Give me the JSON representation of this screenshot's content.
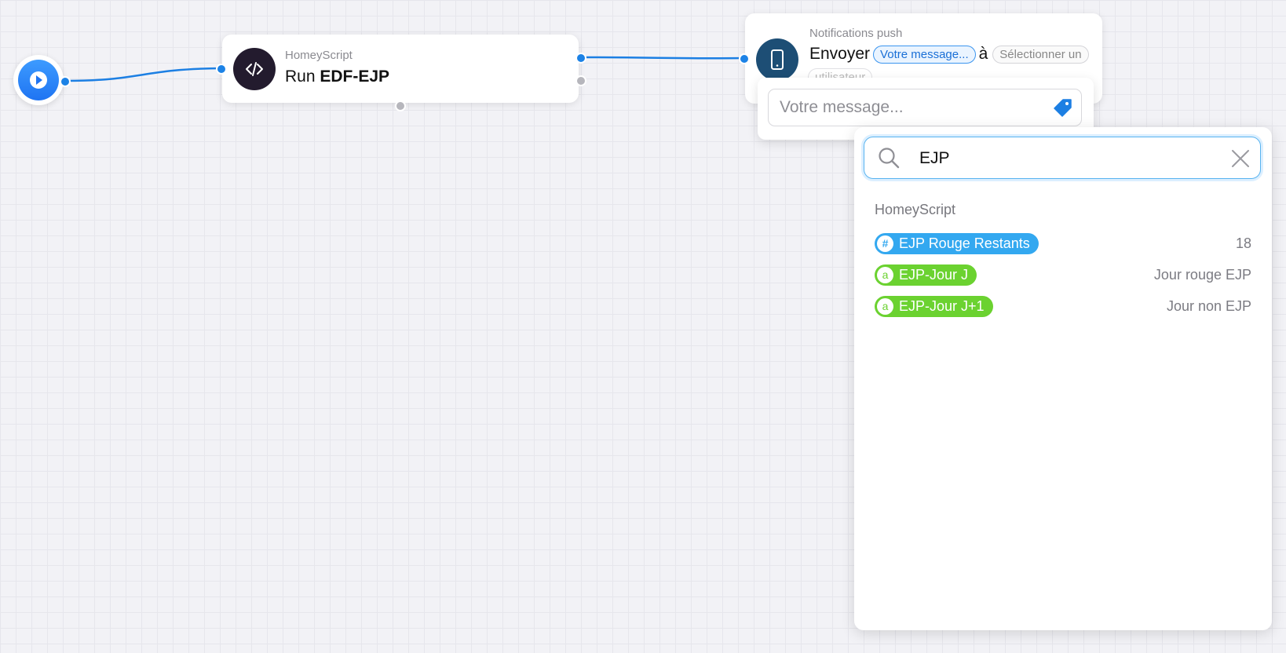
{
  "colors": {
    "number_token": "#33a8f0",
    "text_token": "#6bd230",
    "wire": "#1c7fe3"
  },
  "start_node": {
    "icon": "play-icon"
  },
  "homeyscript_card": {
    "icon": "code-icon",
    "app_name": "HomeyScript",
    "action_prefix": "Run",
    "script_name": "EDF-EJP"
  },
  "notification_card": {
    "icon": "phone-icon",
    "app_name": "Notifications push",
    "verb": "Envoyer",
    "message_pill": "Votre message...",
    "connector": "à",
    "user_pill": "Sélectionner un",
    "user_pill_continued": "utilisateur"
  },
  "message_popover": {
    "placeholder": "Votre message...",
    "tag_icon": "tag-icon"
  },
  "token_panel": {
    "search_icon": "search-icon",
    "search_value": "EJP",
    "clear_icon": "close-icon",
    "group": "HomeyScript",
    "tokens": [
      {
        "type": "number",
        "badge": "#",
        "label": "EJP Rouge Restants",
        "value": "18"
      },
      {
        "type": "text",
        "badge": "a",
        "label": "EJP-Jour J",
        "value": "Jour rouge EJP"
      },
      {
        "type": "text",
        "badge": "a",
        "label": "EJP-Jour J+1",
        "value": "Jour non EJP"
      }
    ]
  }
}
